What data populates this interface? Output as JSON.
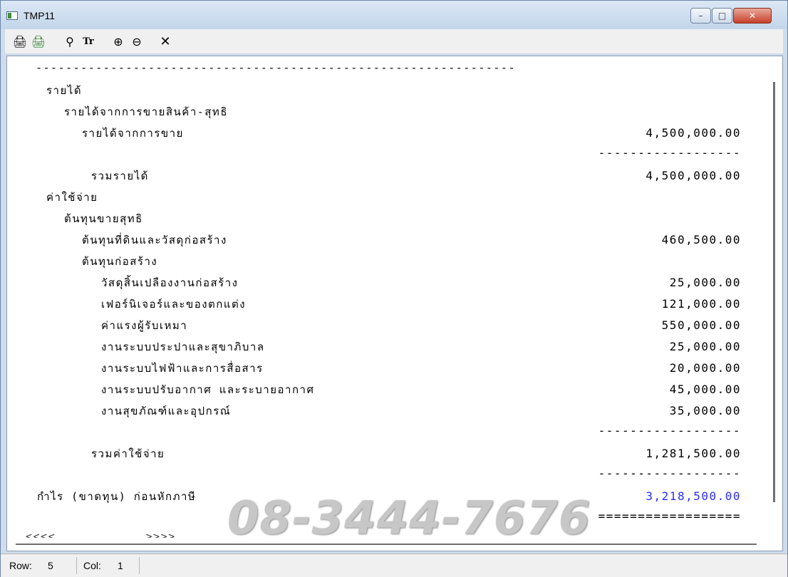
{
  "window": {
    "title": "TMP11",
    "min_glyph": "–",
    "max_glyph": "□",
    "close_glyph": "✕"
  },
  "toolbar": {
    "print1": "🖨",
    "print2": "🖨",
    "find": "⚲",
    "font": "Tr",
    "zoom_in": "⊕",
    "zoom_out": "⊖",
    "close": "✕"
  },
  "report": {
    "rule_top": "----------------------------------------------------------------",
    "lines": [
      {
        "text": "รายได้"
      },
      {
        "text": "รายได้จากการขายสินค้า-สุทธิ"
      },
      {
        "text": "รายได้จากการขาย",
        "amount": "4,500,000.00"
      },
      {
        "text": "รวมรายได้",
        "amount": "4,500,000.00"
      },
      {
        "text": "ค่าใช้จ่าย"
      },
      {
        "text": "ต้นทุนขายสุทธิ"
      },
      {
        "text": "ต้นทุนที่ดินและวัสดุก่อสร้าง",
        "amount": "460,500.00"
      },
      {
        "text": "ต้นทุนก่อสร้าง"
      },
      {
        "text": "วัสดุสิ้นเปลืองงานก่อสร้าง",
        "amount": "25,000.00"
      },
      {
        "text": "เฟอร์นิเจอร์และของตกแต่ง",
        "amount": "121,000.00"
      },
      {
        "text": "ค่าแรงผู้รับเหมา",
        "amount": "550,000.00"
      },
      {
        "text": "งานระบบประปาและสุขาภิบาล",
        "amount": "25,000.00"
      },
      {
        "text": "งานระบบไฟฟ้าและการสื่อสาร",
        "amount": "20,000.00"
      },
      {
        "text": "งานระบบปรับอากาศ และระบายอากาศ",
        "amount": "45,000.00"
      },
      {
        "text": "งานสุขภัณฑ์และอุปกรณ์",
        "amount": "35,000.00"
      },
      {
        "text": "รวมค่าใช้จ่าย",
        "amount": "1,281,500.00"
      },
      {
        "text": "กำไร (ขาดทุน) ก่อนหักภาษี",
        "amount": "3,218,500.00"
      }
    ],
    "subtotal_rule": "------------------",
    "double_rule": "==================",
    "end_marker": "<<<<  ........  >>>>"
  },
  "colors": {
    "profit_amount": "#2a2aff"
  },
  "watermark": "08-3444-7676",
  "status": {
    "row_label": "Row:",
    "row_value": "5",
    "col_label": "Col:",
    "col_value": "1"
  }
}
